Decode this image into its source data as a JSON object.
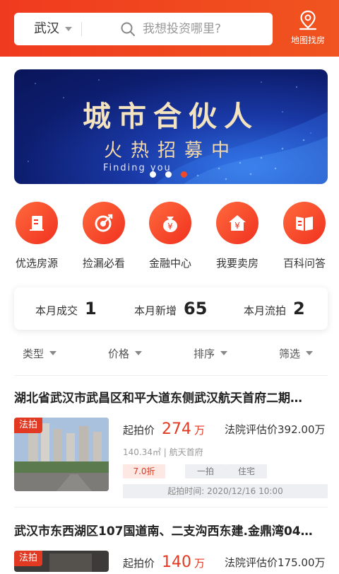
{
  "header": {
    "city": "武汉",
    "search_placeholder": "我想投资哪里?",
    "map_label": "地图找房"
  },
  "banner": {
    "title": "城市合伙人",
    "subtitle": "火热招募中",
    "english": "Finding you",
    "slide_count": 3,
    "active_slide": 3
  },
  "categories": [
    {
      "label": "优选房源",
      "icon": "building-icon"
    },
    {
      "label": "捡漏必看",
      "icon": "target-icon"
    },
    {
      "label": "金融中心",
      "icon": "money-bag-icon"
    },
    {
      "label": "我要卖房",
      "icon": "house-yuan-icon"
    },
    {
      "label": "百科问答",
      "icon": "book-icon"
    }
  ],
  "stats": [
    {
      "label": "本月成交",
      "value": "1"
    },
    {
      "label": "本月新增",
      "value": "65"
    },
    {
      "label": "本月流拍",
      "value": "2"
    }
  ],
  "filters": [
    "类型",
    "价格",
    "排序",
    "筛选"
  ],
  "listings": [
    {
      "title": "湖北省武汉市武昌区和平大道东侧武汉航天首府二期…",
      "badge": "法拍",
      "start_label": "起拍价",
      "start_price": "274",
      "unit": "万",
      "eval_text": "法院评估价392.00万",
      "meta": "140.34㎡ | 航天首府",
      "tags": [
        "7.0折",
        "一拍",
        "住宅"
      ],
      "start_time": "起拍时间: 2020/12/16 10:00"
    },
    {
      "title": "武汉市东西湖区107国道南、二支沟西东建.金鼎湾04…",
      "badge": "法拍",
      "start_label": "起拍价",
      "start_price": "140",
      "unit": "万",
      "eval_text": "法院评估价175.00万"
    }
  ],
  "colors": {
    "accent": "#f03a1f",
    "price": "#e23a22",
    "banner_bg": "#0d1d6e",
    "banner_text": "#f4e3bf"
  }
}
